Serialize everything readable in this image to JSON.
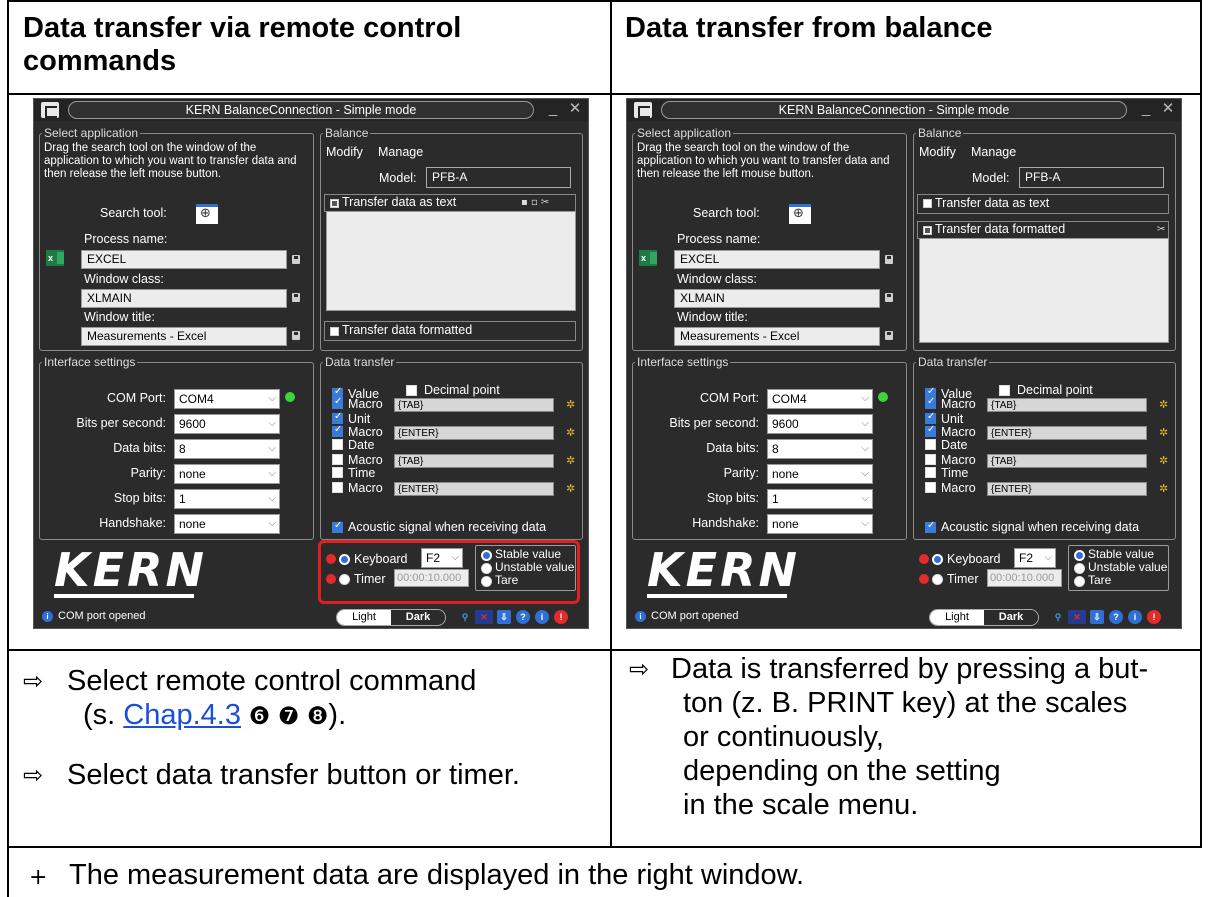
{
  "header": {
    "left_title": "Data transfer via remote control commands",
    "right_title": "Data transfer from balance"
  },
  "windows": [
    {
      "id": "left",
      "title": "KERN BalanceConnection - Simple mode",
      "select_application": {
        "legend": "Select application",
        "instructions": "Drag the search tool on the window of the application to which you want to transfer data and then release the left mouse button.",
        "search_tool_label": "Search tool:",
        "process_name_label": "Process name:",
        "process_name_value": "EXCEL",
        "window_class_label": "Window class:",
        "window_class_value": "XLMAIN",
        "window_title_label": "Window title:",
        "window_title_value": "Measurements - Excel"
      },
      "balance": {
        "legend": "Balance",
        "modify": "Modify",
        "manage": "Manage",
        "model_label": "Model:",
        "model_value": "PFB-A",
        "transfer_text_label": "Transfer data as text",
        "transfer_text_checked": true,
        "transfer_formatted_label": "Transfer data formatted",
        "transfer_formatted_checked": false
      },
      "interface": {
        "legend": "Interface settings",
        "com_port_label": "COM Port:",
        "com_port_value": "COM4",
        "bps_label": "Bits per second:",
        "bps_value": "9600",
        "data_bits_label": "Data bits:",
        "data_bits_value": "8",
        "parity_label": "Parity:",
        "parity_value": "none",
        "stop_bits_label": "Stop bits:",
        "stop_bits_value": "1",
        "handshake_label": "Handshake:",
        "handshake_value": "none"
      },
      "data_transfer": {
        "legend": "Data transfer",
        "items": [
          {
            "label": "Value",
            "checked": true
          },
          {
            "label": "Macro",
            "checked": true,
            "macro": "{TAB}"
          },
          {
            "label": "Unit",
            "checked": true
          },
          {
            "label": "Macro",
            "checked": true,
            "macro": "{ENTER}"
          },
          {
            "label": "Date",
            "checked": false
          },
          {
            "label": "Macro",
            "checked": false,
            "macro": "{TAB}"
          },
          {
            "label": "Time",
            "checked": false
          },
          {
            "label": "Macro",
            "checked": false,
            "macro": "{ENTER}"
          }
        ],
        "decimal_point": "Decimal point",
        "acoustic": "Acoustic signal when receiving data",
        "keyboard_label": "Keyboard",
        "keyboard_key": "F2",
        "timer_label": "Timer",
        "timer_value": "00:00:10.000",
        "stable": "Stable value",
        "unstable": "Unstable value",
        "tare": "Tare"
      },
      "logo": "KERN",
      "status": "COM port opened",
      "theme_light": "Light",
      "theme_dark": "Dark",
      "highlight": true
    },
    {
      "id": "right",
      "title": "KERN BalanceConnection - Simple mode",
      "select_application": {
        "legend": "Select application",
        "instructions": "Drag the search tool on the window of the application to which you want to transfer data and then release the left mouse button.",
        "search_tool_label": "Search tool:",
        "process_name_label": "Process name:",
        "process_name_value": "EXCEL",
        "window_class_label": "Window class:",
        "window_class_value": "XLMAIN",
        "window_title_label": "Window title:",
        "window_title_value": "Measurements - Excel"
      },
      "balance": {
        "legend": "Balance",
        "modify": "Modify",
        "manage": "Manage",
        "model_label": "Model:",
        "model_value": "PFB-A",
        "transfer_text_label": "Transfer data as text",
        "transfer_text_checked": false,
        "transfer_formatted_label": "Transfer data formatted",
        "transfer_formatted_checked": true
      },
      "interface": {
        "legend": "Interface settings",
        "com_port_label": "COM Port:",
        "com_port_value": "COM4",
        "bps_label": "Bits per second:",
        "bps_value": "9600",
        "data_bits_label": "Data bits:",
        "data_bits_value": "8",
        "parity_label": "Parity:",
        "parity_value": "none",
        "stop_bits_label": "Stop bits:",
        "stop_bits_value": "1",
        "handshake_label": "Handshake:",
        "handshake_value": "none"
      },
      "data_transfer": {
        "legend": "Data transfer",
        "items": [
          {
            "label": "Value",
            "checked": true
          },
          {
            "label": "Macro",
            "checked": true,
            "macro": "{TAB}"
          },
          {
            "label": "Unit",
            "checked": true
          },
          {
            "label": "Macro",
            "checked": true,
            "macro": "{ENTER}"
          },
          {
            "label": "Date",
            "checked": false
          },
          {
            "label": "Macro",
            "checked": false,
            "macro": "{TAB}"
          },
          {
            "label": "Time",
            "checked": false
          },
          {
            "label": "Macro",
            "checked": false,
            "macro": "{ENTER}"
          }
        ],
        "decimal_point": "Decimal point",
        "acoustic": "Acoustic signal when receiving data",
        "keyboard_label": "Keyboard",
        "keyboard_key": "F2",
        "timer_label": "Timer",
        "timer_value": "00:00:10.000",
        "stable": "Stable value",
        "unstable": "Unstable value",
        "tare": "Tare"
      },
      "logo": "KERN",
      "status": "COM port opened",
      "theme_light": "Light",
      "theme_dark": "Dark",
      "highlight": false
    }
  ],
  "steps_left": {
    "step1_prefix": "Select remote control command",
    "step1_ref_open": "(s. ",
    "step1_link": "Chap.4.3",
    "step1_markers": " ❻ ❼ ❽",
    "step1_close": ").",
    "step2": "Select data transfer button or timer."
  },
  "steps_right": {
    "line1": "Data is transferred by pressing a but-",
    "line2": "ton (z. B. PRINT key) at the scales",
    "line3": "or continuously,",
    "line4": "depending on the setting",
    "line5": "in the scale menu."
  },
  "footer": "The measurement data are displayed in the right window.",
  "symbols": {
    "arrow": "⇨",
    "plus": "+"
  }
}
